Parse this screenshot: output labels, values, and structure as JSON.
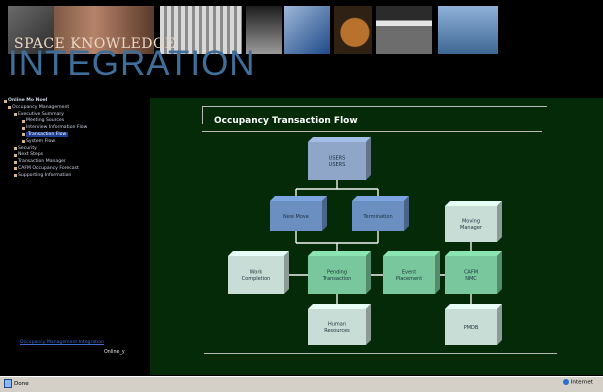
{
  "header": {
    "brand_top": "SPACE KNOWLEDGE",
    "brand_main": "INTEGRATION"
  },
  "sidebar": {
    "items": [
      {
        "label": "Online Mo Noel",
        "indent": 0,
        "bold": true
      },
      {
        "label": "Occupancy Management",
        "indent": 1
      },
      {
        "label": "Executive Summary",
        "indent": 2
      },
      {
        "label": "Meeting Sources",
        "indent": 3
      },
      {
        "label": "Interview Information Flow",
        "indent": 3
      },
      {
        "label": "Transaction Flow",
        "indent": 3,
        "active": true
      },
      {
        "label": "System Flow",
        "indent": 3
      },
      {
        "label": "Security",
        "indent": 2
      },
      {
        "label": "Next Steps",
        "indent": 2
      },
      {
        "label": "Transaction Manager",
        "indent": 2
      },
      {
        "label": "CAFM Occupancy Forecast",
        "indent": 2
      },
      {
        "label": "Supporting Information",
        "indent": 2
      }
    ],
    "footer_link": "Occupancy Management Integration",
    "footer_note": "Online_y"
  },
  "main": {
    "title": "Occupancy Transaction Flow",
    "boxes": [
      {
        "id": "top",
        "lines": [
          "USERS",
          "USERS"
        ],
        "color": "#8fa6c8"
      },
      {
        "id": "newmove",
        "lines": [
          "New Move"
        ],
        "color": "#6c8fc2"
      },
      {
        "id": "termination",
        "lines": [
          "Termination"
        ],
        "color": "#6c8fc2"
      },
      {
        "id": "moving",
        "lines": [
          "Moving",
          "Manager"
        ],
        "color": "#c8ddd6"
      },
      {
        "id": "work",
        "lines": [
          "Work",
          "Completion"
        ],
        "color": "#c8ddd6"
      },
      {
        "id": "pending",
        "lines": [
          "Pending",
          "Transaction"
        ],
        "color": "#79c79c"
      },
      {
        "id": "event",
        "lines": [
          "Event",
          "Placement"
        ],
        "color": "#79c79c"
      },
      {
        "id": "cafm",
        "lines": [
          "CAFM",
          "NMC"
        ],
        "color": "#79c79c"
      },
      {
        "id": "hr",
        "lines": [
          "Human",
          "Resources"
        ],
        "color": "#c8ddd6"
      },
      {
        "id": "pmdb",
        "lines": [
          "PMDB"
        ],
        "color": "#c8ddd6"
      }
    ]
  },
  "statusbar": {
    "left": "Done",
    "right": "Internet"
  }
}
